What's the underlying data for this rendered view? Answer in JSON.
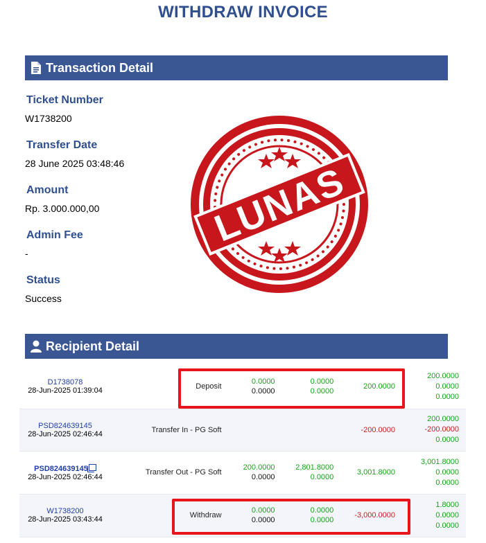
{
  "title": "WITHDRAW INVOICE",
  "transaction": {
    "heading": "Transaction Detail",
    "fields": [
      {
        "label": "Ticket Number",
        "value": "W1738200"
      },
      {
        "label": "Transfer Date",
        "value": "28 June 2025 03:48:46"
      },
      {
        "label": "Amount",
        "value": "Rp. 3.000.000,00"
      },
      {
        "label": "Admin Fee",
        "value": "-"
      },
      {
        "label": "Status",
        "value": "Success"
      }
    ]
  },
  "stamp": {
    "text": "LUNAS",
    "color": "#c8171c"
  },
  "recipient": {
    "heading": "Recipient Detail",
    "rows": [
      {
        "id": "D1738078",
        "date": "28-Jun-2025 01:39:04",
        "type": "Deposit",
        "n1": [
          "0.0000",
          "0.0000"
        ],
        "n2": [
          "0.0000",
          "0.0000"
        ],
        "n3": "200.0000",
        "n4": [
          "200.0000",
          "0.0000",
          "0.0000"
        ]
      },
      {
        "id": "PSD824639145",
        "date": "28-Jun-2025 02:46:44",
        "type": "Transfer In - PG Soft",
        "n1": [
          "",
          ""
        ],
        "n2": [
          "",
          ""
        ],
        "n3": "-200.0000",
        "n4": [
          "200.0000",
          "-200.0000",
          "0.0000"
        ]
      },
      {
        "id": "PSD824639145",
        "date": "28-Jun-2025 02:46:44",
        "type": "Transfer Out - PG Soft",
        "n1": [
          "200.0000",
          "0.0000"
        ],
        "n2": [
          "2,801.8000",
          "0.0000"
        ],
        "n3": "3,001.8000",
        "n4": [
          "3,001.8000",
          "0.0000",
          "0.0000"
        ]
      },
      {
        "id": "W1738200",
        "date": "28-Jun-2025 03:43:44",
        "type": "Withdraw",
        "n1": [
          "0.0000",
          "0.0000"
        ],
        "n2": [
          "0.0000",
          "0.0000"
        ],
        "n3": "-3,000.0000",
        "n4": [
          "1.8000",
          "0.0000",
          "0.0000"
        ]
      }
    ]
  },
  "colors": {
    "header_bar": "#3a5794",
    "title": "#2f4f8f",
    "positive": "#17a31a",
    "negative": "#c62020",
    "highlight": "#e8141b"
  }
}
